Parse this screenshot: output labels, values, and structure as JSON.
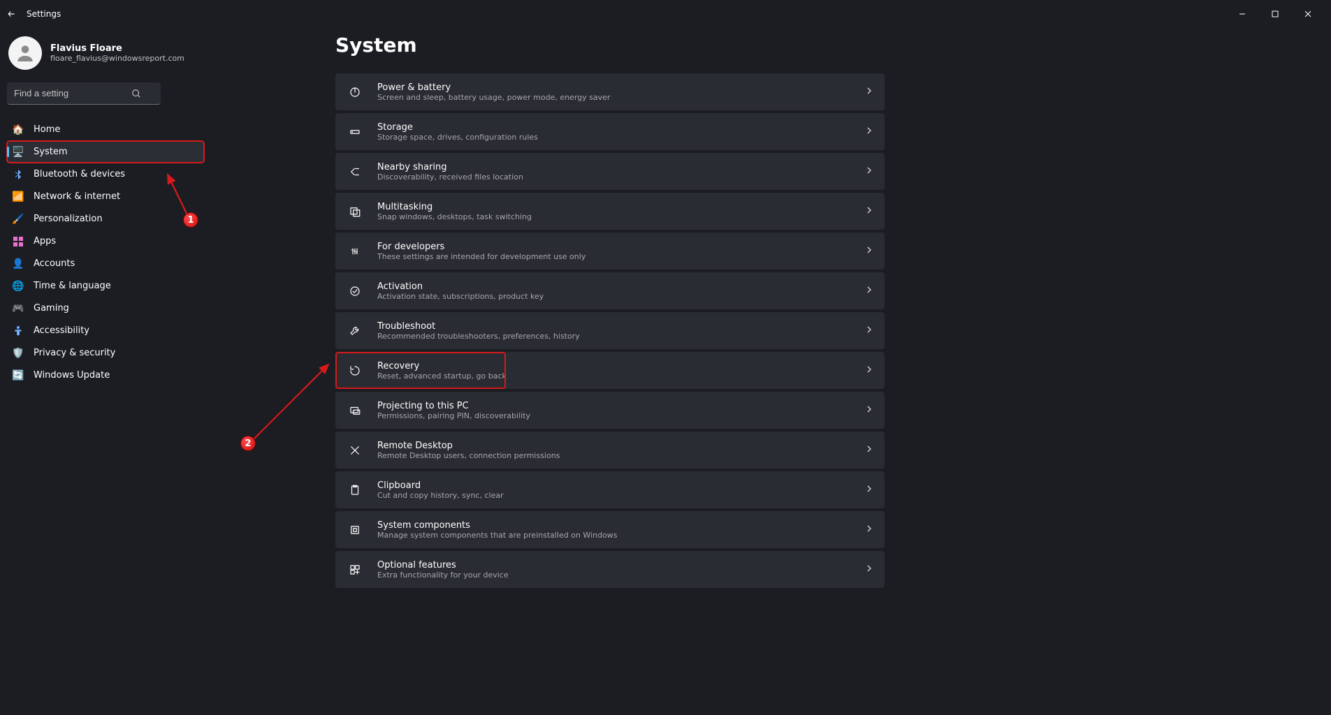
{
  "window": {
    "title": "Settings"
  },
  "account": {
    "name": "Flavius Floare",
    "email": "floare_flavius@windowsreport.com"
  },
  "search": {
    "placeholder": "Find a setting"
  },
  "nav": {
    "items": [
      {
        "icon": "🏠",
        "label": "Home",
        "selected": false,
        "name": "nav-home"
      },
      {
        "icon": "🖥️",
        "label": "System",
        "selected": true,
        "name": "nav-system"
      },
      {
        "icon": "ble",
        "label": "Bluetooth & devices",
        "selected": false,
        "name": "nav-bluetooth"
      },
      {
        "icon": "📶",
        "label": "Network & internet",
        "selected": false,
        "name": "nav-network"
      },
      {
        "icon": "🖌️",
        "label": "Personalization",
        "selected": false,
        "name": "nav-personalization"
      },
      {
        "icon": "app",
        "label": "Apps",
        "selected": false,
        "name": "nav-apps"
      },
      {
        "icon": "👤",
        "label": "Accounts",
        "selected": false,
        "name": "nav-accounts"
      },
      {
        "icon": "🌐",
        "label": "Time & language",
        "selected": false,
        "name": "nav-time-language"
      },
      {
        "icon": "🎮",
        "label": "Gaming",
        "selected": false,
        "name": "nav-gaming"
      },
      {
        "icon": "acc",
        "label": "Accessibility",
        "selected": false,
        "name": "nav-accessibility"
      },
      {
        "icon": "🛡️",
        "label": "Privacy & security",
        "selected": false,
        "name": "nav-privacy"
      },
      {
        "icon": "🔄",
        "label": "Windows Update",
        "selected": false,
        "name": "nav-update"
      }
    ]
  },
  "page": {
    "title": "System",
    "items": [
      {
        "name": "power-battery",
        "title": "Power & battery",
        "desc": "Screen and sleep, battery usage, power mode, energy saver"
      },
      {
        "name": "storage",
        "title": "Storage",
        "desc": "Storage space, drives, configuration rules"
      },
      {
        "name": "nearby-sharing",
        "title": "Nearby sharing",
        "desc": "Discoverability, received files location"
      },
      {
        "name": "multitasking",
        "title": "Multitasking",
        "desc": "Snap windows, desktops, task switching"
      },
      {
        "name": "for-developers",
        "title": "For developers",
        "desc": "These settings are intended for development use only"
      },
      {
        "name": "activation",
        "title": "Activation",
        "desc": "Activation state, subscriptions, product key"
      },
      {
        "name": "troubleshoot",
        "title": "Troubleshoot",
        "desc": "Recommended troubleshooters, preferences, history"
      },
      {
        "name": "recovery",
        "title": "Recovery",
        "desc": "Reset, advanced startup, go back",
        "highlight": true
      },
      {
        "name": "projecting",
        "title": "Projecting to this PC",
        "desc": "Permissions, pairing PIN, discoverability"
      },
      {
        "name": "remote-desktop",
        "title": "Remote Desktop",
        "desc": "Remote Desktop users, connection permissions"
      },
      {
        "name": "clipboard",
        "title": "Clipboard",
        "desc": "Cut and copy history, sync, clear"
      },
      {
        "name": "system-components",
        "title": "System components",
        "desc": "Manage system components that are preinstalled on Windows"
      },
      {
        "name": "optional-features",
        "title": "Optional features",
        "desc": "Extra functionality for your device"
      }
    ]
  },
  "annotations": {
    "badge1": "1",
    "badge2": "2"
  }
}
